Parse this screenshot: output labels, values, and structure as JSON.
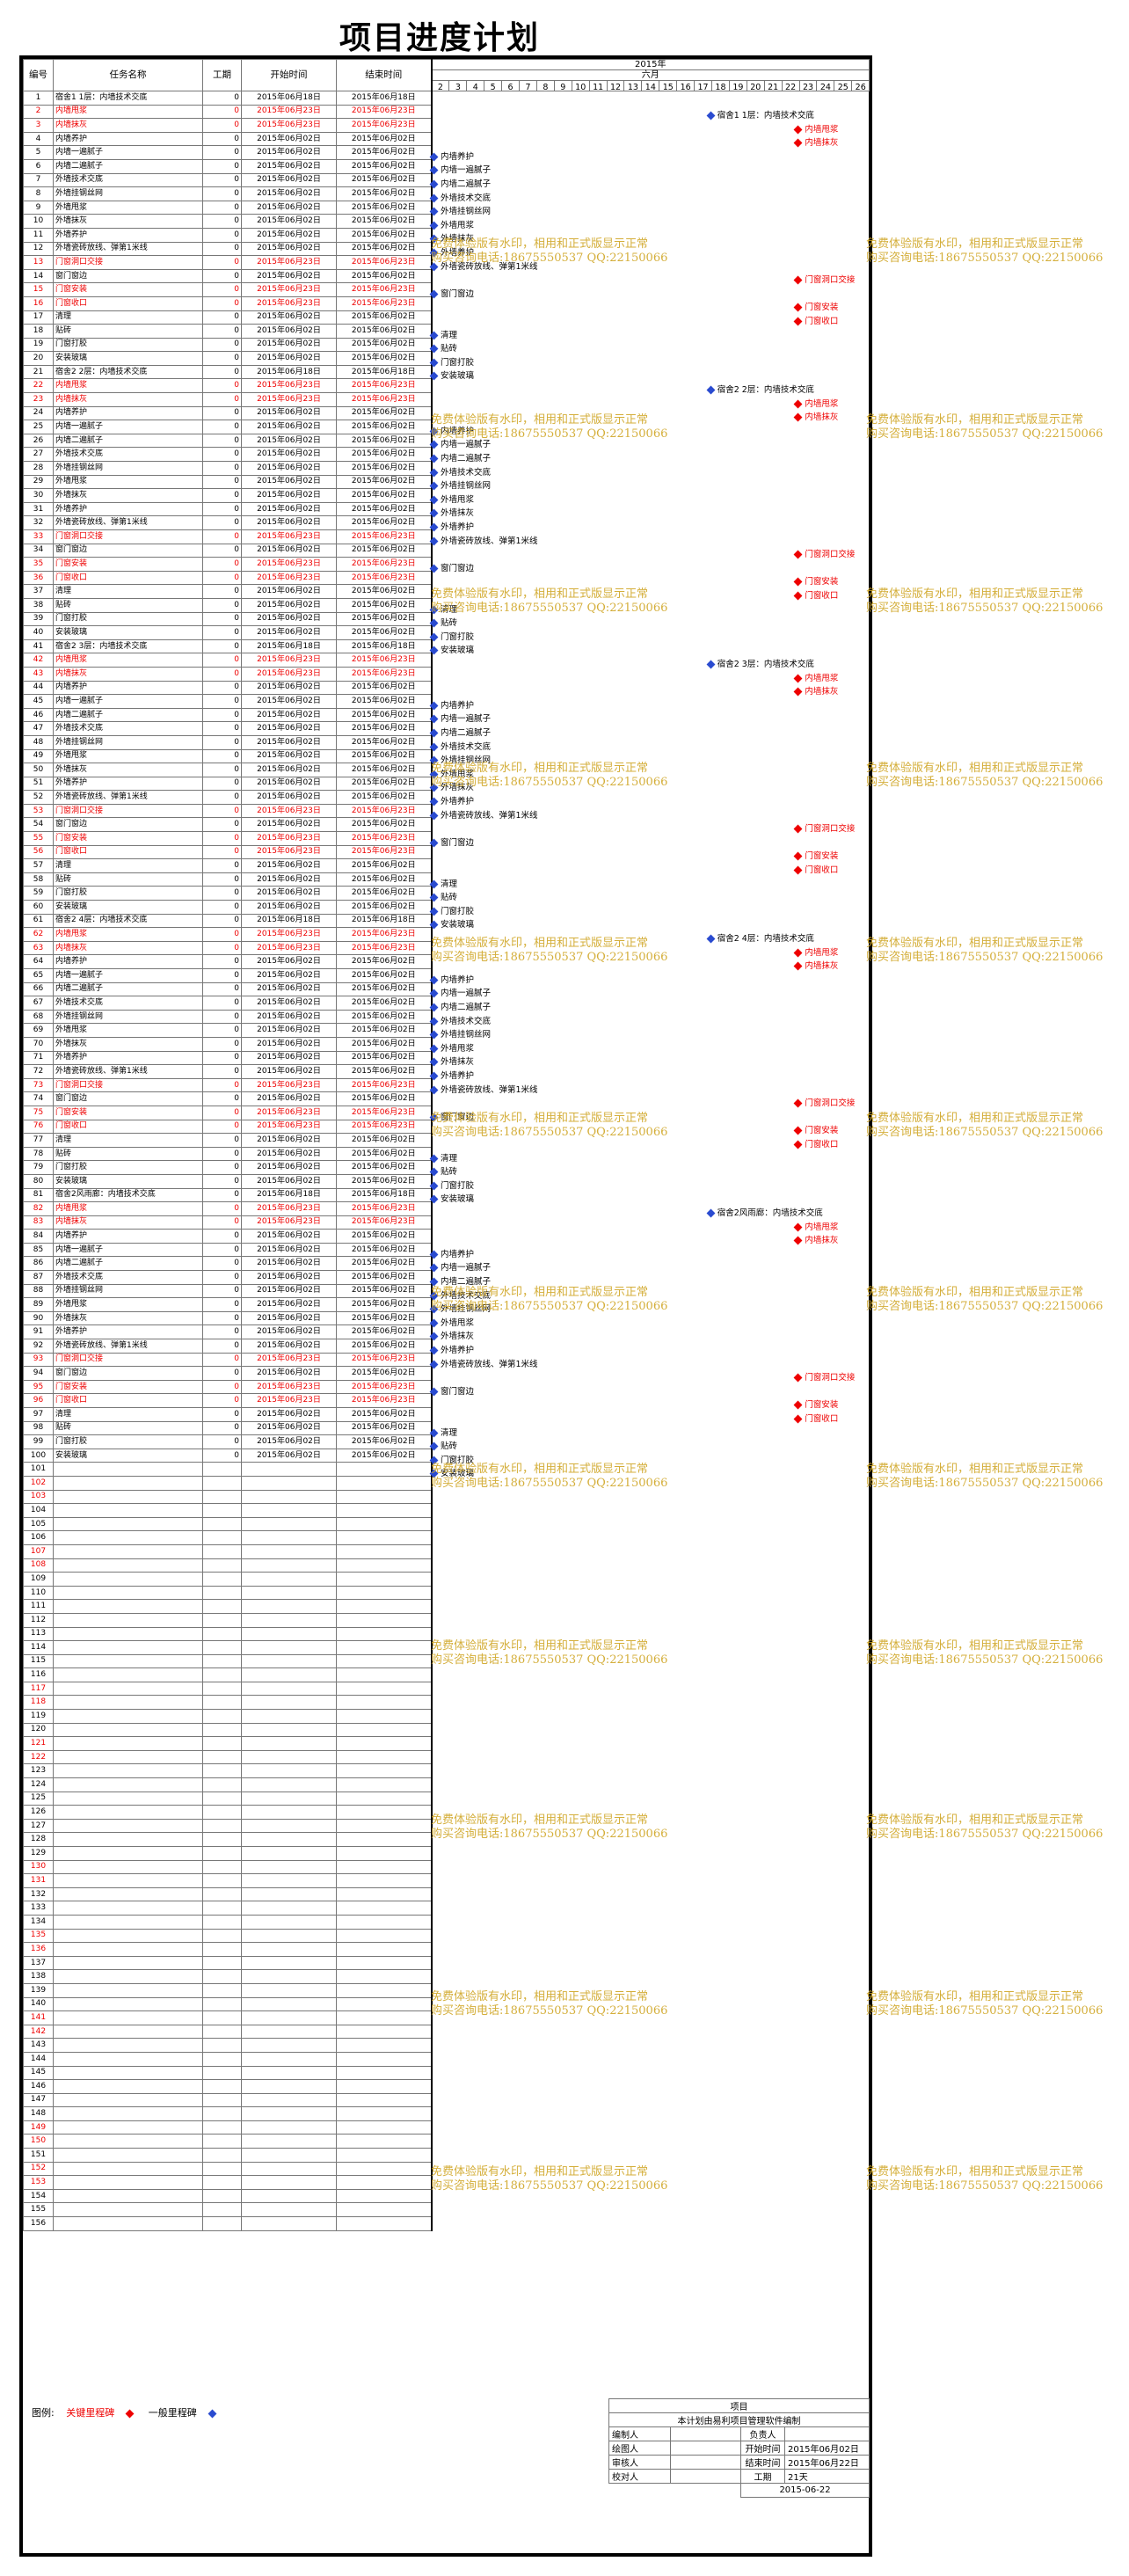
{
  "title": "项目进度计划",
  "columns": {
    "id": "编号",
    "name": "任务名称",
    "duration": "工期",
    "start": "开始时间",
    "end": "结束时间"
  },
  "timeline": {
    "year": "2015年",
    "month": "六月",
    "days": [
      "2",
      "3",
      "4",
      "5",
      "6",
      "7",
      "8",
      "9",
      "10",
      "11",
      "12",
      "13",
      "14",
      "15",
      "16",
      "17",
      "18",
      "19",
      "20",
      "21",
      "22",
      "23",
      "24",
      "25",
      "26"
    ]
  },
  "colors": {
    "key": "#e00000",
    "normal": "#2a4bd0",
    "watermark": "#d1a82a"
  },
  "groups": [
    "宿舍1",
    "宿舍2",
    "宿舍3",
    "宿舍4",
    "宿舍2风雨廊"
  ],
  "empty_rows_to": 156,
  "watermark": {
    "line1": "免费体验版有水印，相用和正式版显示正常",
    "line2": "购买咨询电话:18675550537 QQ:22150066"
  },
  "legend": {
    "label": "图例:",
    "key": "关键里程碑",
    "normal": "一般里程碑"
  },
  "info": {
    "project": "项目",
    "note": "本计划由易利项目管理软件编制",
    "rows": [
      {
        "a": "编制人",
        "b": "",
        "c": "负责人",
        "d": ""
      },
      {
        "a": "绘图人",
        "b": "",
        "c": "开始时间",
        "d": "2015年06月02日"
      },
      {
        "a": "审核人",
        "b": "",
        "c": "结束时间",
        "d": "2015年06月22日"
      },
      {
        "a": "校对人",
        "b": "",
        "c": "工期",
        "d": "21天"
      }
    ],
    "date": "2015-06-22"
  },
  "tasks": [
    {
      "id": "1",
      "name": "宿舍1 1层：内墙技术交底",
      "dur": "0",
      "start": "2015年06月18日",
      "end": "2015年06月18日",
      "key": false
    },
    {
      "id": "2",
      "name": "内墙甩浆",
      "dur": "0",
      "start": "2015年06月23日",
      "end": "2015年06月23日",
      "key": true
    },
    {
      "id": "3",
      "name": "内墙抹灰",
      "dur": "0",
      "start": "2015年06月23日",
      "end": "2015年06月23日",
      "key": true
    },
    {
      "id": "4",
      "name": "内墙养护",
      "dur": "0",
      "start": "2015年06月02日",
      "end": "2015年06月02日",
      "key": false
    },
    {
      "id": "5",
      "name": "内墙一遍腻子",
      "dur": "0",
      "start": "2015年06月02日",
      "end": "2015年06月02日",
      "key": false
    },
    {
      "id": "6",
      "name": "内墙二遍腻子",
      "dur": "0",
      "start": "2015年06月02日",
      "end": "2015年06月02日",
      "key": false
    },
    {
      "id": "7",
      "name": "外墙技术交底",
      "dur": "0",
      "start": "2015年06月02日",
      "end": "2015年06月02日",
      "key": false
    },
    {
      "id": "8",
      "name": "外墙挂钢丝网",
      "dur": "0",
      "start": "2015年06月02日",
      "end": "2015年06月02日",
      "key": false
    },
    {
      "id": "9",
      "name": "外墙甩浆",
      "dur": "0",
      "start": "2015年06月02日",
      "end": "2015年06月02日",
      "key": false
    },
    {
      "id": "10",
      "name": "外墙抹灰",
      "dur": "0",
      "start": "2015年06月02日",
      "end": "2015年06月02日",
      "key": false
    },
    {
      "id": "11",
      "name": "外墙养护",
      "dur": "0",
      "start": "2015年06月02日",
      "end": "2015年06月02日",
      "key": false
    },
    {
      "id": "12",
      "name": "外墙瓷砖放线、弹第1米线",
      "dur": "0",
      "start": "2015年06月02日",
      "end": "2015年06月02日",
      "key": false
    },
    {
      "id": "13",
      "name": "门窗洞口交接",
      "dur": "0",
      "start": "2015年06月23日",
      "end": "2015年06月23日",
      "key": true
    },
    {
      "id": "14",
      "name": "窗门窗边",
      "dur": "0",
      "start": "2015年06月02日",
      "end": "2015年06月02日",
      "key": false
    },
    {
      "id": "15",
      "name": "门窗安装",
      "dur": "0",
      "start": "2015年06月23日",
      "end": "2015年06月23日",
      "key": true
    },
    {
      "id": "16",
      "name": "门窗收口",
      "dur": "0",
      "start": "2015年06月23日",
      "end": "2015年06月23日",
      "key": true
    },
    {
      "id": "17",
      "name": "清理",
      "dur": "0",
      "start": "2015年06月02日",
      "end": "2015年06月02日",
      "key": false
    },
    {
      "id": "18",
      "name": "贴砖",
      "dur": "0",
      "start": "2015年06月02日",
      "end": "2015年06月02日",
      "key": false
    },
    {
      "id": "19",
      "name": "门窗打胶",
      "dur": "0",
      "start": "2015年06月02日",
      "end": "2015年06月02日",
      "key": false
    },
    {
      "id": "20",
      "name": "安装玻璃",
      "dur": "0",
      "start": "2015年06月02日",
      "end": "2015年06月02日",
      "key": false
    },
    {
      "id": "21",
      "name": "宿舍2 2层：内墙技术交底",
      "dur": "0",
      "start": "2015年06月18日",
      "end": "2015年06月18日",
      "key": false
    },
    {
      "id": "22",
      "name": "内墙甩浆",
      "dur": "0",
      "start": "2015年06月23日",
      "end": "2015年06月23日",
      "key": true
    },
    {
      "id": "23",
      "name": "内墙抹灰",
      "dur": "0",
      "start": "2015年06月23日",
      "end": "2015年06月23日",
      "key": true
    },
    {
      "id": "24",
      "name": "内墙养护",
      "dur": "0",
      "start": "2015年06月02日",
      "end": "2015年06月02日",
      "key": false
    },
    {
      "id": "25",
      "name": "内墙一遍腻子",
      "dur": "0",
      "start": "2015年06月02日",
      "end": "2015年06月02日",
      "key": false
    },
    {
      "id": "26",
      "name": "内墙二遍腻子",
      "dur": "0",
      "start": "2015年06月02日",
      "end": "2015年06月02日",
      "key": false
    },
    {
      "id": "27",
      "name": "外墙技术交底",
      "dur": "0",
      "start": "2015年06月02日",
      "end": "2015年06月02日",
      "key": false
    },
    {
      "id": "28",
      "name": "外墙挂钢丝网",
      "dur": "0",
      "start": "2015年06月02日",
      "end": "2015年06月02日",
      "key": false
    },
    {
      "id": "29",
      "name": "外墙甩浆",
      "dur": "0",
      "start": "2015年06月02日",
      "end": "2015年06月02日",
      "key": false
    },
    {
      "id": "30",
      "name": "外墙抹灰",
      "dur": "0",
      "start": "2015年06月02日",
      "end": "2015年06月02日",
      "key": false
    },
    {
      "id": "31",
      "name": "外墙养护",
      "dur": "0",
      "start": "2015年06月02日",
      "end": "2015年06月02日",
      "key": false
    },
    {
      "id": "32",
      "name": "外墙瓷砖放线、弹第1米线",
      "dur": "0",
      "start": "2015年06月02日",
      "end": "2015年06月02日",
      "key": false
    },
    {
      "id": "33",
      "name": "门窗洞口交接",
      "dur": "0",
      "start": "2015年06月23日",
      "end": "2015年06月23日",
      "key": true
    },
    {
      "id": "34",
      "name": "窗门窗边",
      "dur": "0",
      "start": "2015年06月02日",
      "end": "2015年06月02日",
      "key": false
    },
    {
      "id": "35",
      "name": "门窗安装",
      "dur": "0",
      "start": "2015年06月23日",
      "end": "2015年06月23日",
      "key": true
    },
    {
      "id": "36",
      "name": "门窗收口",
      "dur": "0",
      "start": "2015年06月23日",
      "end": "2015年06月23日",
      "key": true
    },
    {
      "id": "37",
      "name": "清理",
      "dur": "0",
      "start": "2015年06月02日",
      "end": "2015年06月02日",
      "key": false
    },
    {
      "id": "38",
      "name": "贴砖",
      "dur": "0",
      "start": "2015年06月02日",
      "end": "2015年06月02日",
      "key": false
    },
    {
      "id": "39",
      "name": "门窗打胶",
      "dur": "0",
      "start": "2015年06月02日",
      "end": "2015年06月02日",
      "key": false
    },
    {
      "id": "40",
      "name": "安装玻璃",
      "dur": "0",
      "start": "2015年06月02日",
      "end": "2015年06月02日",
      "key": false
    },
    {
      "id": "41",
      "name": "宿舍2 3层：内墙技术交底",
      "dur": "0",
      "start": "2015年06月18日",
      "end": "2015年06月18日",
      "key": false
    },
    {
      "id": "42",
      "name": "内墙甩浆",
      "dur": "0",
      "start": "2015年06月23日",
      "end": "2015年06月23日",
      "key": true
    },
    {
      "id": "43",
      "name": "内墙抹灰",
      "dur": "0",
      "start": "2015年06月23日",
      "end": "2015年06月23日",
      "key": true
    },
    {
      "id": "44",
      "name": "内墙养护",
      "dur": "0",
      "start": "2015年06月02日",
      "end": "2015年06月02日",
      "key": false
    },
    {
      "id": "45",
      "name": "内墙一遍腻子",
      "dur": "0",
      "start": "2015年06月02日",
      "end": "2015年06月02日",
      "key": false
    },
    {
      "id": "46",
      "name": "内墙二遍腻子",
      "dur": "0",
      "start": "2015年06月02日",
      "end": "2015年06月02日",
      "key": false
    },
    {
      "id": "47",
      "name": "外墙技术交底",
      "dur": "0",
      "start": "2015年06月02日",
      "end": "2015年06月02日",
      "key": false
    },
    {
      "id": "48",
      "name": "外墙挂钢丝网",
      "dur": "0",
      "start": "2015年06月02日",
      "end": "2015年06月02日",
      "key": false
    },
    {
      "id": "49",
      "name": "外墙甩浆",
      "dur": "0",
      "start": "2015年06月02日",
      "end": "2015年06月02日",
      "key": false
    },
    {
      "id": "50",
      "name": "外墙抹灰",
      "dur": "0",
      "start": "2015年06月02日",
      "end": "2015年06月02日",
      "key": false
    },
    {
      "id": "51",
      "name": "外墙养护",
      "dur": "0",
      "start": "2015年06月02日",
      "end": "2015年06月02日",
      "key": false
    },
    {
      "id": "52",
      "name": "外墙瓷砖放线、弹第1米线",
      "dur": "0",
      "start": "2015年06月02日",
      "end": "2015年06月02日",
      "key": false
    },
    {
      "id": "53",
      "name": "门窗洞口交接",
      "dur": "0",
      "start": "2015年06月23日",
      "end": "2015年06月23日",
      "key": true
    },
    {
      "id": "54",
      "name": "窗门窗边",
      "dur": "0",
      "start": "2015年06月02日",
      "end": "2015年06月02日",
      "key": false
    },
    {
      "id": "55",
      "name": "门窗安装",
      "dur": "0",
      "start": "2015年06月23日",
      "end": "2015年06月23日",
      "key": true
    },
    {
      "id": "56",
      "name": "门窗收口",
      "dur": "0",
      "start": "2015年06月23日",
      "end": "2015年06月23日",
      "key": true
    },
    {
      "id": "57",
      "name": "清理",
      "dur": "0",
      "start": "2015年06月02日",
      "end": "2015年06月02日",
      "key": false
    },
    {
      "id": "58",
      "name": "贴砖",
      "dur": "0",
      "start": "2015年06月02日",
      "end": "2015年06月02日",
      "key": false
    },
    {
      "id": "59",
      "name": "门窗打胶",
      "dur": "0",
      "start": "2015年06月02日",
      "end": "2015年06月02日",
      "key": false
    },
    {
      "id": "60",
      "name": "安装玻璃",
      "dur": "0",
      "start": "2015年06月02日",
      "end": "2015年06月02日",
      "key": false
    },
    {
      "id": "61",
      "name": "宿舍2 4层：内墙技术交底",
      "dur": "0",
      "start": "2015年06月18日",
      "end": "2015年06月18日",
      "key": false
    },
    {
      "id": "62",
      "name": "内墙甩浆",
      "dur": "0",
      "start": "2015年06月23日",
      "end": "2015年06月23日",
      "key": true
    },
    {
      "id": "63",
      "name": "内墙抹灰",
      "dur": "0",
      "start": "2015年06月23日",
      "end": "2015年06月23日",
      "key": true
    },
    {
      "id": "64",
      "name": "内墙养护",
      "dur": "0",
      "start": "2015年06月02日",
      "end": "2015年06月02日",
      "key": false
    },
    {
      "id": "65",
      "name": "内墙一遍腻子",
      "dur": "0",
      "start": "2015年06月02日",
      "end": "2015年06月02日",
      "key": false
    },
    {
      "id": "66",
      "name": "内墙二遍腻子",
      "dur": "0",
      "start": "2015年06月02日",
      "end": "2015年06月02日",
      "key": false
    },
    {
      "id": "67",
      "name": "外墙技术交底",
      "dur": "0",
      "start": "2015年06月02日",
      "end": "2015年06月02日",
      "key": false
    },
    {
      "id": "68",
      "name": "外墙挂钢丝网",
      "dur": "0",
      "start": "2015年06月02日",
      "end": "2015年06月02日",
      "key": false
    },
    {
      "id": "69",
      "name": "外墙甩浆",
      "dur": "0",
      "start": "2015年06月02日",
      "end": "2015年06月02日",
      "key": false
    },
    {
      "id": "70",
      "name": "外墙抹灰",
      "dur": "0",
      "start": "2015年06月02日",
      "end": "2015年06月02日",
      "key": false
    },
    {
      "id": "71",
      "name": "外墙养护",
      "dur": "0",
      "start": "2015年06月02日",
      "end": "2015年06月02日",
      "key": false
    },
    {
      "id": "72",
      "name": "外墙瓷砖放线、弹第1米线",
      "dur": "0",
      "start": "2015年06月02日",
      "end": "2015年06月02日",
      "key": false
    },
    {
      "id": "73",
      "name": "门窗洞口交接",
      "dur": "0",
      "start": "2015年06月23日",
      "end": "2015年06月23日",
      "key": true
    },
    {
      "id": "74",
      "name": "窗门窗边",
      "dur": "0",
      "start": "2015年06月02日",
      "end": "2015年06月02日",
      "key": false
    },
    {
      "id": "75",
      "name": "门窗安装",
      "dur": "0",
      "start": "2015年06月23日",
      "end": "2015年06月23日",
      "key": true
    },
    {
      "id": "76",
      "name": "门窗收口",
      "dur": "0",
      "start": "2015年06月23日",
      "end": "2015年06月23日",
      "key": true
    },
    {
      "id": "77",
      "name": "清理",
      "dur": "0",
      "start": "2015年06月02日",
      "end": "2015年06月02日",
      "key": false
    },
    {
      "id": "78",
      "name": "贴砖",
      "dur": "0",
      "start": "2015年06月02日",
      "end": "2015年06月02日",
      "key": false
    },
    {
      "id": "79",
      "name": "门窗打胶",
      "dur": "0",
      "start": "2015年06月02日",
      "end": "2015年06月02日",
      "key": false
    },
    {
      "id": "80",
      "name": "安装玻璃",
      "dur": "0",
      "start": "2015年06月02日",
      "end": "2015年06月02日",
      "key": false
    },
    {
      "id": "81",
      "name": "宿舍2风雨廊：内墙技术交底",
      "dur": "0",
      "start": "2015年06月18日",
      "end": "2015年06月18日",
      "key": false
    },
    {
      "id": "82",
      "name": "内墙甩浆",
      "dur": "0",
      "start": "2015年06月23日",
      "end": "2015年06月23日",
      "key": true
    },
    {
      "id": "83",
      "name": "内墙抹灰",
      "dur": "0",
      "start": "2015年06月23日",
      "end": "2015年06月23日",
      "key": true
    },
    {
      "id": "84",
      "name": "内墙养护",
      "dur": "0",
      "start": "2015年06月02日",
      "end": "2015年06月02日",
      "key": false
    },
    {
      "id": "85",
      "name": "内墙一遍腻子",
      "dur": "0",
      "start": "2015年06月02日",
      "end": "2015年06月02日",
      "key": false
    },
    {
      "id": "86",
      "name": "内墙二遍腻子",
      "dur": "0",
      "start": "2015年06月02日",
      "end": "2015年06月02日",
      "key": false
    },
    {
      "id": "87",
      "name": "外墙技术交底",
      "dur": "0",
      "start": "2015年06月02日",
      "end": "2015年06月02日",
      "key": false
    },
    {
      "id": "88",
      "name": "外墙挂钢丝网",
      "dur": "0",
      "start": "2015年06月02日",
      "end": "2015年06月02日",
      "key": false
    },
    {
      "id": "89",
      "name": "外墙甩浆",
      "dur": "0",
      "start": "2015年06月02日",
      "end": "2015年06月02日",
      "key": false
    },
    {
      "id": "90",
      "name": "外墙抹灰",
      "dur": "0",
      "start": "2015年06月02日",
      "end": "2015年06月02日",
      "key": false
    },
    {
      "id": "91",
      "name": "外墙养护",
      "dur": "0",
      "start": "2015年06月02日",
      "end": "2015年06月02日",
      "key": false
    },
    {
      "id": "92",
      "name": "外墙瓷砖放线、弹第1米线",
      "dur": "0",
      "start": "2015年06月02日",
      "end": "2015年06月02日",
      "key": false
    },
    {
      "id": "93",
      "name": "门窗洞口交接",
      "dur": "0",
      "start": "2015年06月23日",
      "end": "2015年06月23日",
      "key": true
    },
    {
      "id": "94",
      "name": "窗门窗边",
      "dur": "0",
      "start": "2015年06月02日",
      "end": "2015年06月02日",
      "key": false
    },
    {
      "id": "95",
      "name": "门窗安装",
      "dur": "0",
      "start": "2015年06月23日",
      "end": "2015年06月23日",
      "key": true
    },
    {
      "id": "96",
      "name": "门窗收口",
      "dur": "0",
      "start": "2015年06月23日",
      "end": "2015年06月23日",
      "key": true
    },
    {
      "id": "97",
      "name": "清理",
      "dur": "0",
      "start": "2015年06月02日",
      "end": "2015年06月02日",
      "key": false
    },
    {
      "id": "98",
      "name": "贴砖",
      "dur": "0",
      "start": "2015年06月02日",
      "end": "2015年06月02日",
      "key": false
    },
    {
      "id": "99",
      "name": "门窗打胶",
      "dur": "0",
      "start": "2015年06月02日",
      "end": "2015年06月02日",
      "key": false
    },
    {
      "id": "100",
      "name": "安装玻璃",
      "dur": "0",
      "start": "2015年06月02日",
      "end": "2015年06月02日",
      "key": false
    }
  ]
}
